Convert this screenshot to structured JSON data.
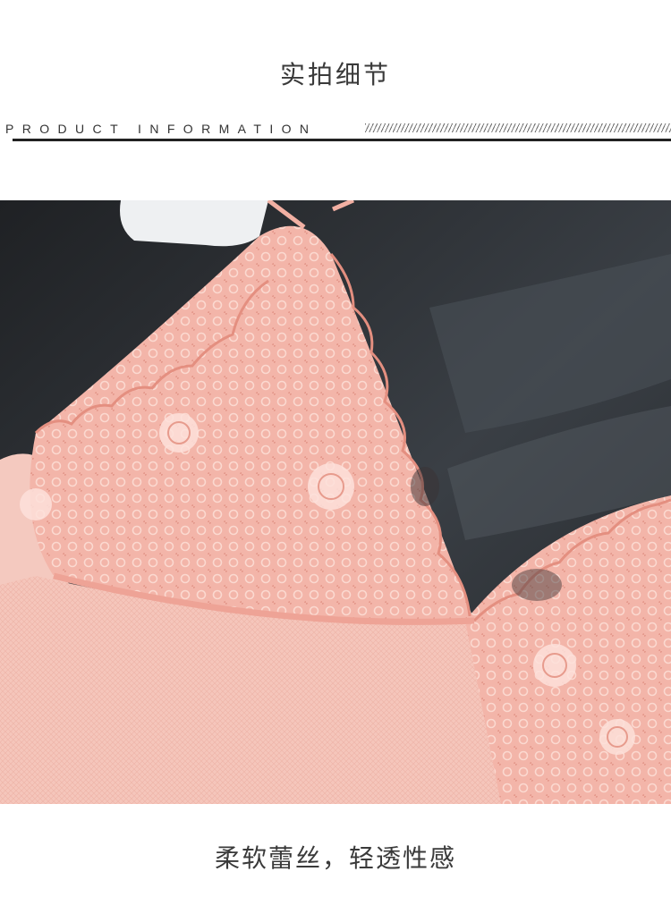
{
  "header": {
    "title": "实拍细节",
    "info_label": "PRODUCT INFORMATION"
  },
  "photo": {
    "subject": "lace-garment-detail-photo",
    "colors": {
      "lace": "#f2b2a6",
      "mesh": "#f6c7bc",
      "background": "#2a2d30"
    }
  },
  "caption": {
    "text": "柔软蕾丝，轻透性感"
  }
}
